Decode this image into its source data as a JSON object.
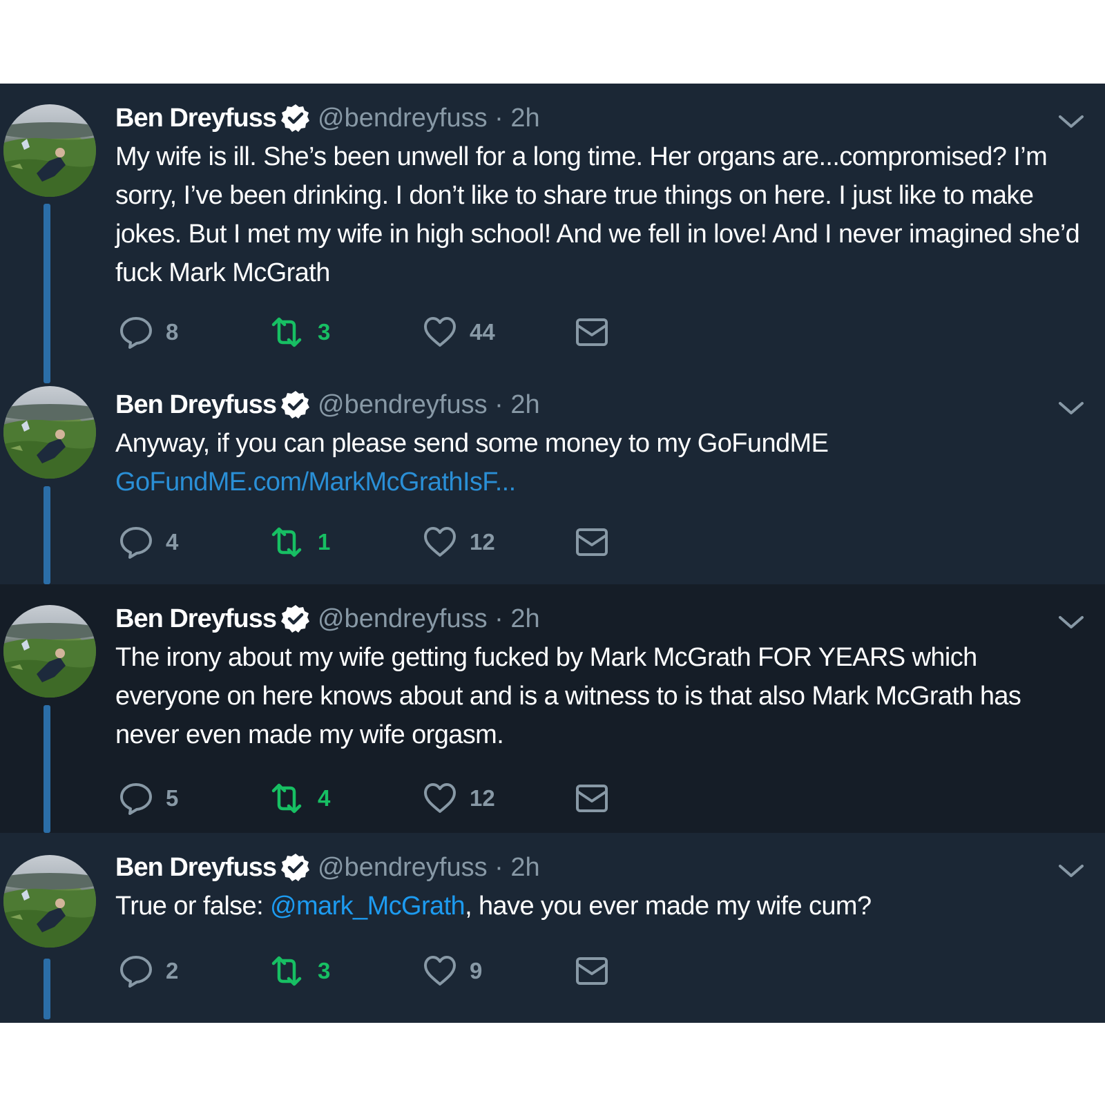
{
  "tweets": [
    {
      "name": "Ben Dreyfuss",
      "handle_time": "@bendreyfuss · 2h",
      "text": "My wife is ill. She’s been unwell for a long time. Her organs are...compromised? I’m sorry, I’ve been drinking. I don’t like to share true things on here. I just like to make jokes. But I met my wife in high school! And we fell in love! And I never imagined she’d fuck Mark McGrath",
      "replies": "8",
      "retweets": "3",
      "likes": "44"
    },
    {
      "name": "Ben Dreyfuss",
      "handle_time": "@bendreyfuss · 2h",
      "text": "Anyway, if you can please send some money to my GoFundME",
      "link": "GoFundME.com/MarkMcGrathIsF...",
      "replies": "4",
      "retweets": "1",
      "likes": "12"
    },
    {
      "name": "Ben Dreyfuss",
      "handle_time": "@bendreyfuss · 2h",
      "text": "The irony about my wife getting fucked by Mark McGrath FOR YEARS which everyone on here knows about and is a witness to is that also Mark McGrath has never even made my wife orgasm.",
      "replies": "5",
      "retweets": "4",
      "likes": "12"
    },
    {
      "name": "Ben Dreyfuss",
      "handle_time": "@bendreyfuss · 2h",
      "text_before": "True or false: ",
      "mention": "@mark_McGrath",
      "text_after": ", have you ever made my wife cum?",
      "replies": "2",
      "retweets": "3",
      "likes": "9"
    }
  ],
  "colors": {
    "background": "#1b2735",
    "highlight_background": "#151d27",
    "link": "#1d9bf0",
    "retweet_green": "#17bf63",
    "muted": "#8899a6",
    "thread_line": "#2b6ea8"
  }
}
